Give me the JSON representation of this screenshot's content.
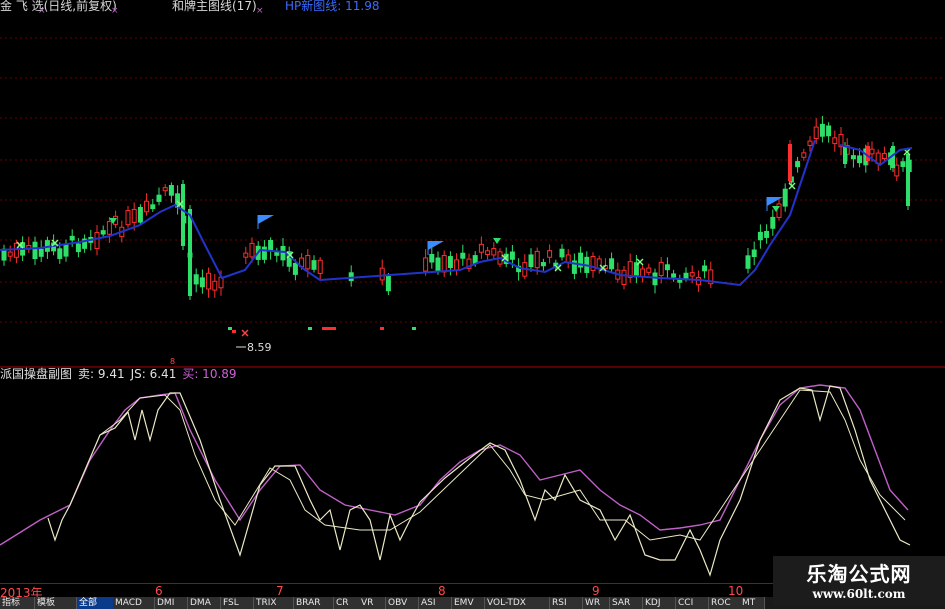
{
  "title_bar": {
    "text1": "金 飞 选(日线,前复权)",
    "text2": "和牌主图线(17)",
    "text3": "HP新图线: 11.98",
    "marks": [
      "×",
      "×",
      "×"
    ]
  },
  "annotation": {
    "low_label": "8.59",
    "marker": "8"
  },
  "indicator": {
    "name": "派国操盘副图",
    "sell_label": "卖: 9.41",
    "js_label": "JS: 6.41",
    "buy_label": "买: 10.89"
  },
  "date_axis": {
    "labels": [
      "2013年",
      "6",
      "7",
      "8",
      "9",
      "10"
    ]
  },
  "tabs": [
    "指标",
    "模板",
    "全部",
    "MACD",
    "DMI",
    "DMA",
    "FSL",
    "TRIX",
    "BRAR",
    "CR",
    "VR",
    "OBV",
    "ASI",
    "EMV",
    "VOL-TDX",
    "RSI",
    "WR",
    "SAR",
    "KDJ",
    "CCI",
    "ROC",
    "MT"
  ],
  "watermark": {
    "line1": "乐淘公式网",
    "line2": "www.60lt.com"
  },
  "colors": {
    "background": "#000000",
    "up": "#ff2d2d",
    "down": "#2ee06a",
    "ma_line": "#2233cc",
    "osc_fast": "#ece9c4",
    "osc_slow": "#c060c8",
    "divider": "#b00000"
  }
}
